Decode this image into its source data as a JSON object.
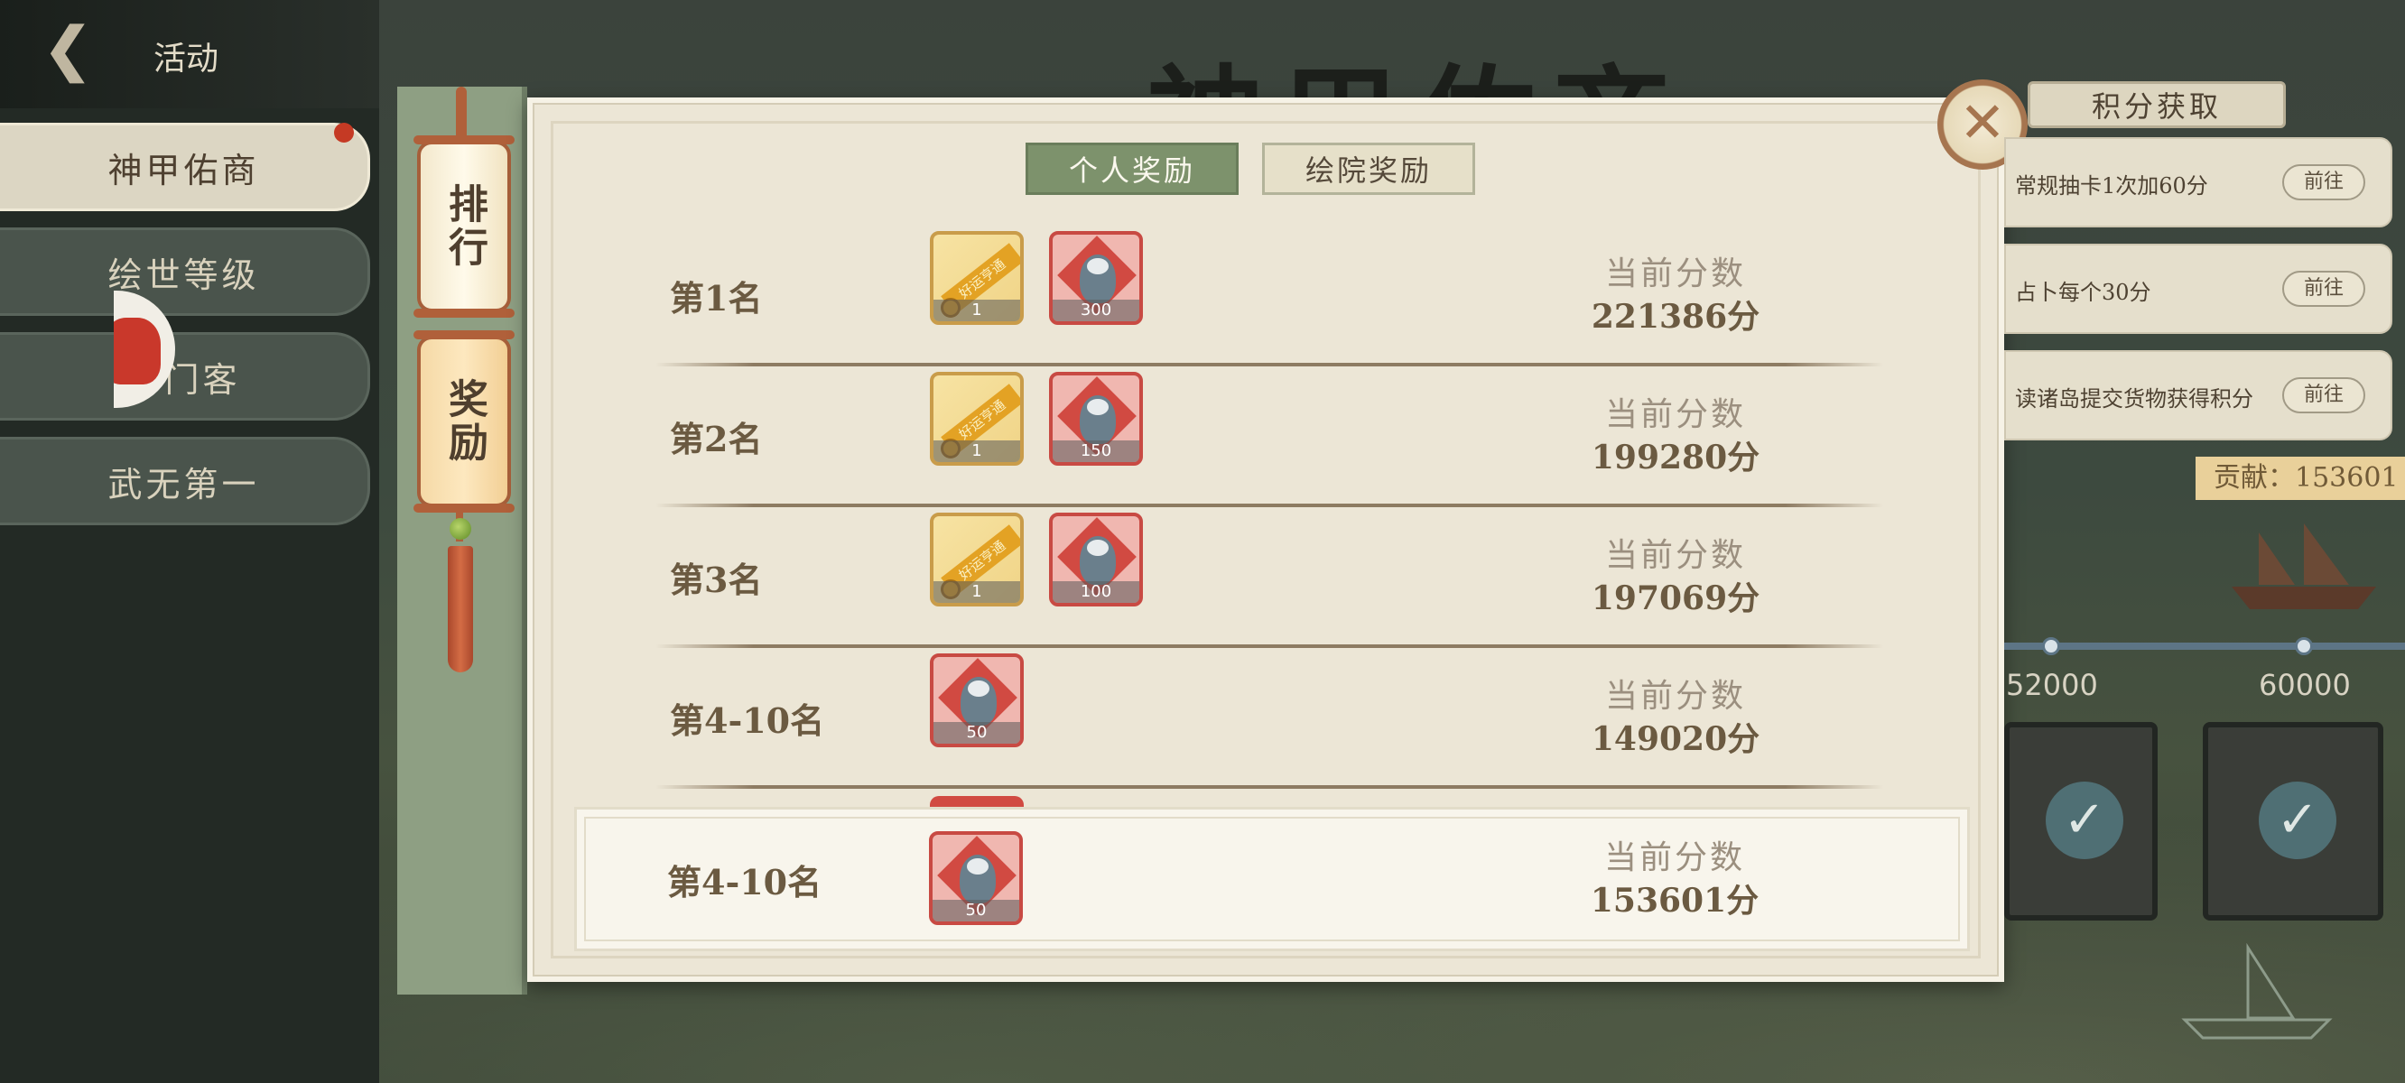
{
  "sidebar": {
    "back_title": "活动",
    "items": [
      {
        "label": "神甲佑商",
        "active": true
      },
      {
        "label": "绘世等级",
        "active": false
      },
      {
        "label": "募门客",
        "active": false
      },
      {
        "label": "武无第一",
        "active": false
      }
    ]
  },
  "background": {
    "event_title": "神甲佑商"
  },
  "vertical_tabs": [
    {
      "label": "排行",
      "active": false
    },
    {
      "label": "奖励",
      "active": true
    }
  ],
  "reward_tabs": [
    {
      "label": "个人奖励",
      "active": true
    },
    {
      "label": "绘院奖励",
      "active": false
    }
  ],
  "score_label": "当前分数",
  "ribbon_text": "好运亨通",
  "rank_rows": [
    {
      "rank": "第1名",
      "rewards": [
        {
          "type": "ribbon-item",
          "count": "1"
        },
        {
          "type": "portrait-card",
          "count": "300"
        }
      ],
      "score": "221386分"
    },
    {
      "rank": "第2名",
      "rewards": [
        {
          "type": "ribbon-item",
          "count": "1"
        },
        {
          "type": "portrait-card",
          "count": "150"
        }
      ],
      "score": "199280分"
    },
    {
      "rank": "第3名",
      "rewards": [
        {
          "type": "ribbon-item",
          "count": "1"
        },
        {
          "type": "portrait-card",
          "count": "100"
        }
      ],
      "score": "197069分"
    },
    {
      "rank": "第4-10名",
      "rewards": [
        {
          "type": "portrait-card",
          "count": "50"
        }
      ],
      "score": "149020分"
    }
  ],
  "my_rank": {
    "rank": "第4-10名",
    "rewards": [
      {
        "type": "portrait-card",
        "count": "50"
      }
    ],
    "score": "153601分"
  },
  "right_panel": {
    "header": "积分获取",
    "quests": [
      {
        "text": "常规抽卡1次加60分",
        "button": "前往"
      },
      {
        "text": "占卜每个30分",
        "button": "前往"
      },
      {
        "text": "读诸岛提交货物获得积分",
        "button": "前往"
      }
    ],
    "contribution": "贡献：153601",
    "milestones": [
      "52000",
      "60000"
    ]
  }
}
